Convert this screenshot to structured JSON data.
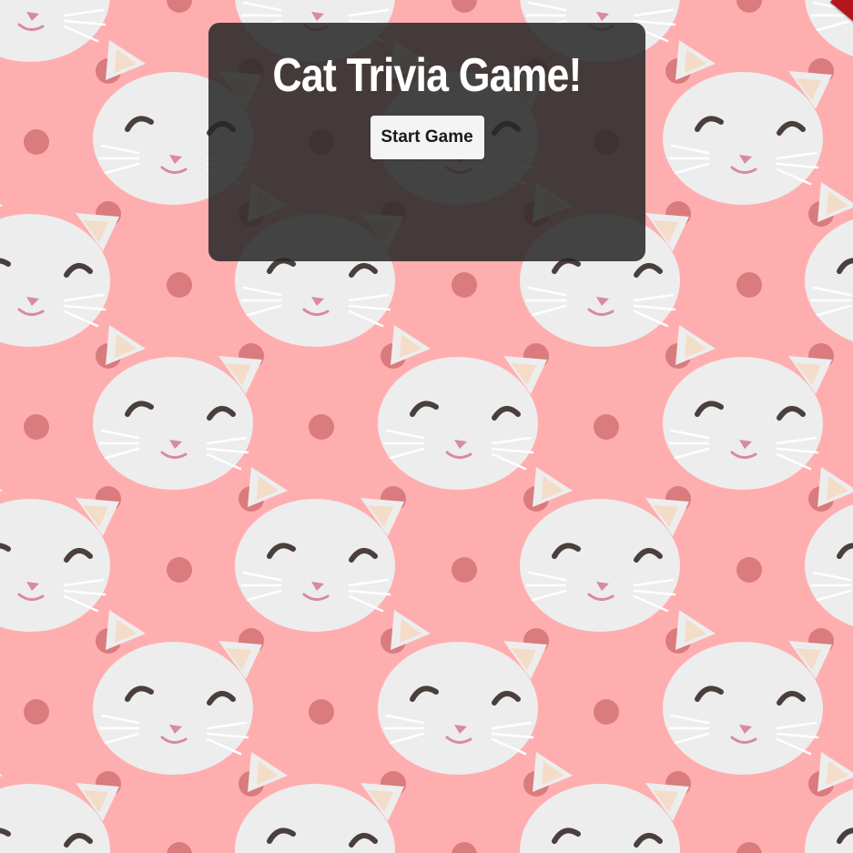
{
  "page": {
    "title": "Cat Trivia Game!",
    "start_button_label": "Start Game"
  },
  "background": {
    "pattern": "cat-face-polka-dot",
    "base_color": "#ffaeb0",
    "dot_color": "#da7b7e",
    "cat_color": "#ededed",
    "ear_color": "#f3dcc8"
  },
  "panel": {
    "bg_color": "#262626"
  },
  "decoration": {
    "corner_ribbon_color": "#b3171d"
  }
}
